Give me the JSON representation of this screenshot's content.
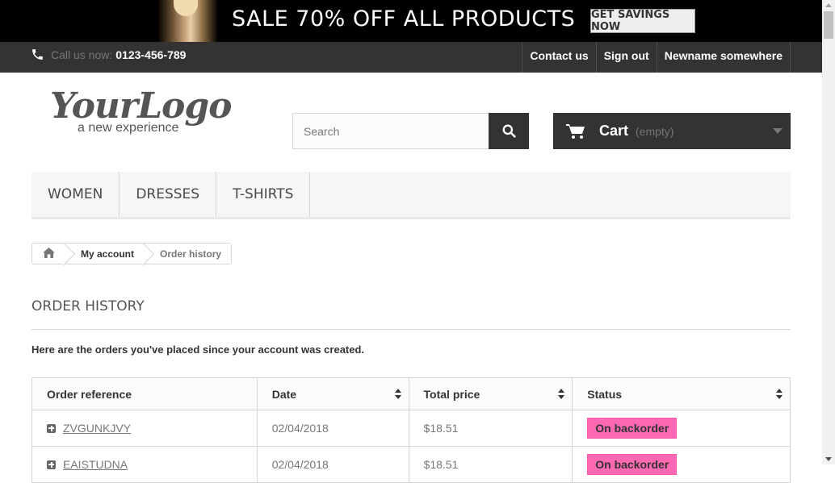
{
  "banner": {
    "headline": "SALE 70% OFF ALL PRODUCTS",
    "cta": "GET SAVINGS NOW"
  },
  "topnav": {
    "phone_label": "Call us now:",
    "phone_number": "0123-456-789",
    "links": [
      "Contact us",
      "Sign out",
      "Newname somewhere"
    ]
  },
  "logo": {
    "word": "YourLogo",
    "tagline": "a new experience"
  },
  "search": {
    "placeholder": "Search"
  },
  "cart": {
    "label": "Cart",
    "status": "(empty)"
  },
  "menu": [
    "WOMEN",
    "DRESSES",
    "T-SHIRTS"
  ],
  "breadcrumb": {
    "parent": "My account",
    "current": "Order history"
  },
  "page": {
    "title": "ORDER HISTORY",
    "intro": "Here are the orders you've placed since your account was created."
  },
  "table": {
    "headers": [
      "Order reference",
      "Date",
      "Total price",
      "Status"
    ],
    "rows": [
      {
        "reference": "ZVGUNKJVY",
        "date": "02/04/2018",
        "total": "$18.51",
        "status": "On backorder"
      },
      {
        "reference": "EAISTUDNA",
        "date": "02/04/2018",
        "total": "$18.51",
        "status": "On backorder"
      }
    ]
  },
  "colors": {
    "status_backorder": "#ff69b4",
    "dark": "#333333"
  }
}
